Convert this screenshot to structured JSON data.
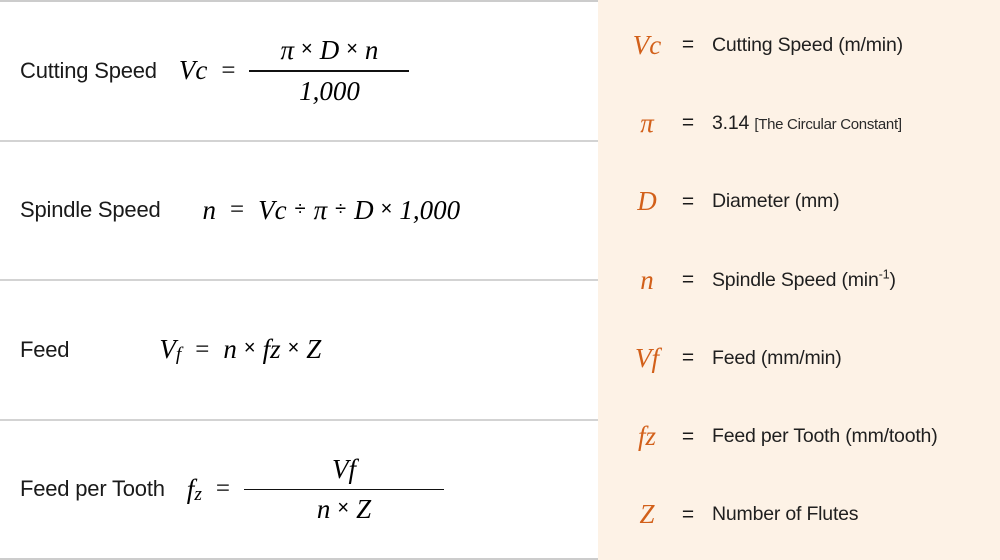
{
  "colors": {
    "accent_orange": "#D2601A",
    "right_panel_bg": "#FDF2E6",
    "left_panel_bg": "#FFFFFF",
    "divider": "#D3D3D3",
    "text": "#1A1A1A"
  },
  "formulas": [
    {
      "label": "Cutting Speed",
      "lhs": "Vc",
      "eq": "=",
      "numerator": [
        "π",
        "×",
        "D",
        "×",
        "n"
      ],
      "denominator": [
        "1,000"
      ],
      "type": "fraction"
    },
    {
      "label": "Spindle Speed",
      "lhs": "n",
      "eq": "=",
      "expression": [
        "Vc",
        "÷",
        "π",
        "÷",
        "D",
        "×",
        "1,000"
      ],
      "type": "inline"
    },
    {
      "label": "Feed",
      "lhs_main": "V",
      "lhs_sub": "f",
      "eq": "=",
      "expression": [
        "n",
        "×",
        "fz",
        "×",
        "Z"
      ],
      "type": "inline"
    },
    {
      "label": "Feed per Tooth",
      "lhs_main": "f",
      "lhs_sub": "z",
      "eq": "=",
      "numerator": [
        "Vf"
      ],
      "denominator": [
        "n",
        "×",
        "Z"
      ],
      "type": "fraction"
    }
  ],
  "legend": [
    {
      "symbol": "Vc",
      "eq": "=",
      "description": "Cutting Speed (m/min)",
      "note": ""
    },
    {
      "symbol": "π",
      "eq": "=",
      "description": "3.14",
      "note": "[The Circular Constant]"
    },
    {
      "symbol": "D",
      "eq": "=",
      "description": "Diameter (mm)",
      "note": ""
    },
    {
      "symbol": "n",
      "eq": "=",
      "description_pre": "Spindle Speed (min",
      "superscript": "-1",
      "description_post": ")",
      "note": ""
    },
    {
      "symbol": "Vf",
      "eq": "=",
      "description": "Feed (mm/min)",
      "note": ""
    },
    {
      "symbol": "fz",
      "eq": "=",
      "description": "Feed per Tooth (mm/tooth)",
      "note": ""
    },
    {
      "symbol": "Z",
      "eq": "=",
      "description": "Number of Flutes",
      "note": ""
    }
  ]
}
